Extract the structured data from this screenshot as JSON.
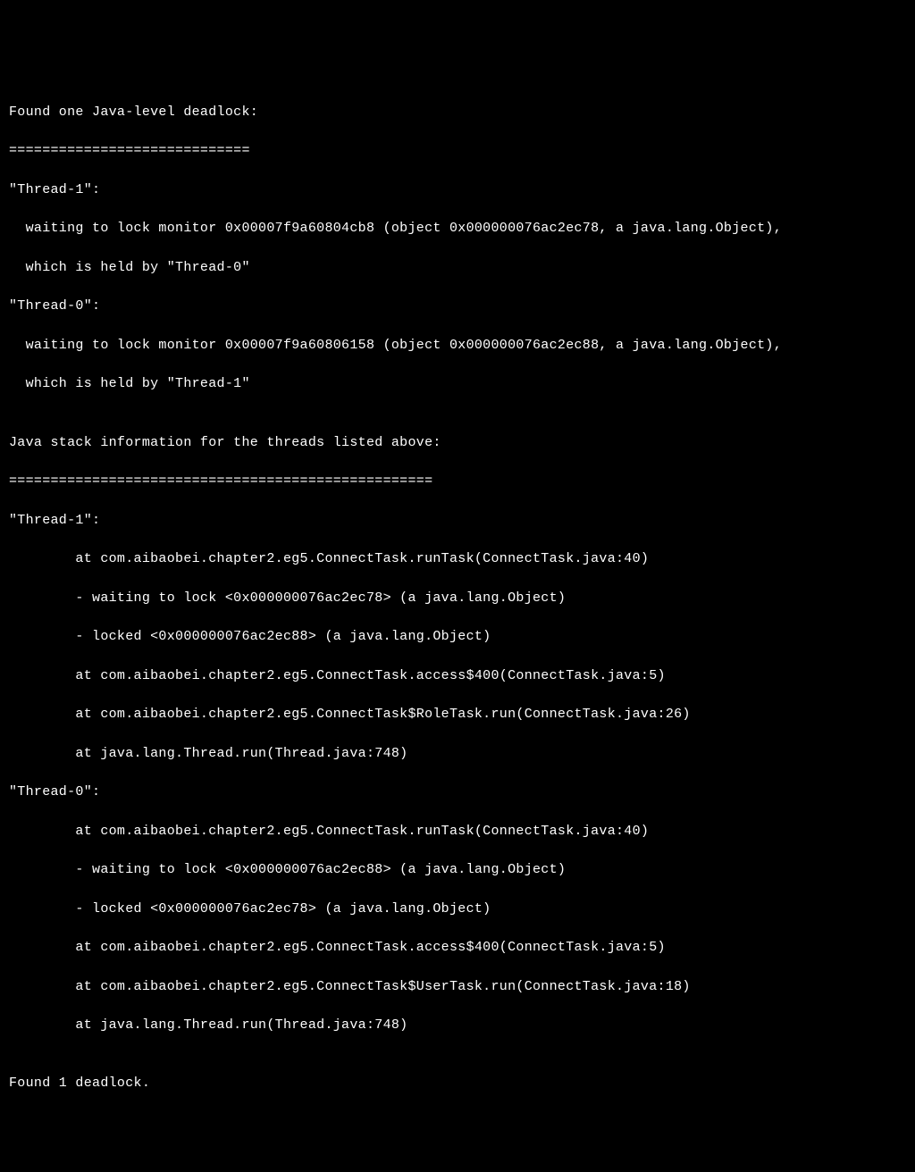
{
  "terminal": {
    "header": "Found one Java-level deadlock:",
    "separator1": "=============================",
    "thread1_name": "\"Thread-1\":",
    "thread1_waiting": "  waiting to lock monitor 0x00007f9a60804cb8 (object 0x000000076ac2ec78, a java.lang.Object),",
    "thread1_heldby": "  which is held by \"Thread-0\"",
    "thread0_name": "\"Thread-0\":",
    "thread0_waiting": "  waiting to lock monitor 0x00007f9a60806158 (object 0x000000076ac2ec88, a java.lang.Object),",
    "thread0_heldby": "  which is held by \"Thread-1\"",
    "blank1": "",
    "stackinfo_header": "Java stack information for the threads listed above:",
    "separator2": "===================================================",
    "st1_name": "\"Thread-1\":",
    "st1_line1": "        at com.aibaobei.chapter2.eg5.ConnectTask.runTask(ConnectTask.java:40)",
    "st1_line2": "        - waiting to lock <0x000000076ac2ec78> (a java.lang.Object)",
    "st1_line3": "        - locked <0x000000076ac2ec88> (a java.lang.Object)",
    "st1_line4": "        at com.aibaobei.chapter2.eg5.ConnectTask.access$400(ConnectTask.java:5)",
    "st1_line5": "        at com.aibaobei.chapter2.eg5.ConnectTask$RoleTask.run(ConnectTask.java:26)",
    "st1_line6": "        at java.lang.Thread.run(Thread.java:748)",
    "st0_name": "\"Thread-0\":",
    "st0_line1": "        at com.aibaobei.chapter2.eg5.ConnectTask.runTask(ConnectTask.java:40)",
    "st0_line2": "        - waiting to lock <0x000000076ac2ec88> (a java.lang.Object)",
    "st0_line3": "        - locked <0x000000076ac2ec78> (a java.lang.Object)",
    "st0_line4": "        at com.aibaobei.chapter2.eg5.ConnectTask.access$400(ConnectTask.java:5)",
    "st0_line5": "        at com.aibaobei.chapter2.eg5.ConnectTask$UserTask.run(ConnectTask.java:18)",
    "st0_line6": "        at java.lang.Thread.run(Thread.java:748)",
    "blank2": "",
    "footer": "Found 1 deadlock."
  }
}
